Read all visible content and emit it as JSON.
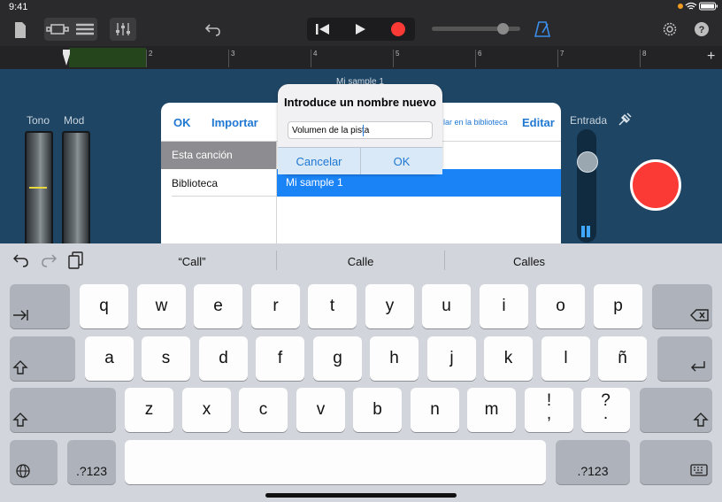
{
  "status": {
    "time": "9:41"
  },
  "ruler": {
    "marks": [
      "2",
      "3",
      "4",
      "5",
      "6",
      "7",
      "8"
    ]
  },
  "region": {
    "label": "Mi sample 1"
  },
  "controls": {
    "tono": "Tono",
    "mod": "Mod",
    "entrada": "Entrada"
  },
  "panel": {
    "ok": "OK",
    "importar": "Importar",
    "biblioteca_link": "lar en la biblioteca",
    "editar": "Editar",
    "sidebar": [
      "Esta canción",
      "Biblioteca"
    ],
    "selected_item": "Mi sample 1"
  },
  "alert": {
    "title": "Introduce un nombre nuevo",
    "field_value": "Volumen de la pista",
    "cancel": "Cancelar",
    "ok": "OK"
  },
  "keyboard": {
    "suggestions": [
      "“Call”",
      "Calle",
      "Calles"
    ],
    "row1": [
      "q",
      "w",
      "e",
      "r",
      "t",
      "y",
      "u",
      "i",
      "o",
      "p"
    ],
    "row2": [
      "a",
      "s",
      "d",
      "f",
      "g",
      "h",
      "j",
      "k",
      "l",
      "ñ"
    ],
    "row3": [
      "z",
      "x",
      "c",
      "v",
      "b",
      "n",
      "m"
    ],
    "punct1": {
      "top": "!",
      "bottom": ","
    },
    "punct2": {
      "top": "?",
      "bottom": "."
    },
    "num_label": ".?123",
    "tab_icon": "tab-icon",
    "delete_icon": "delete-icon",
    "return_icon": "return-icon",
    "shift_icon": "shift-icon",
    "globe_icon": "globe-icon",
    "hide_icon": "hide-keyboard-icon"
  },
  "colors": {
    "record": "#fb3a35",
    "accent": "#2078d3",
    "selection": "#1a84f7"
  }
}
